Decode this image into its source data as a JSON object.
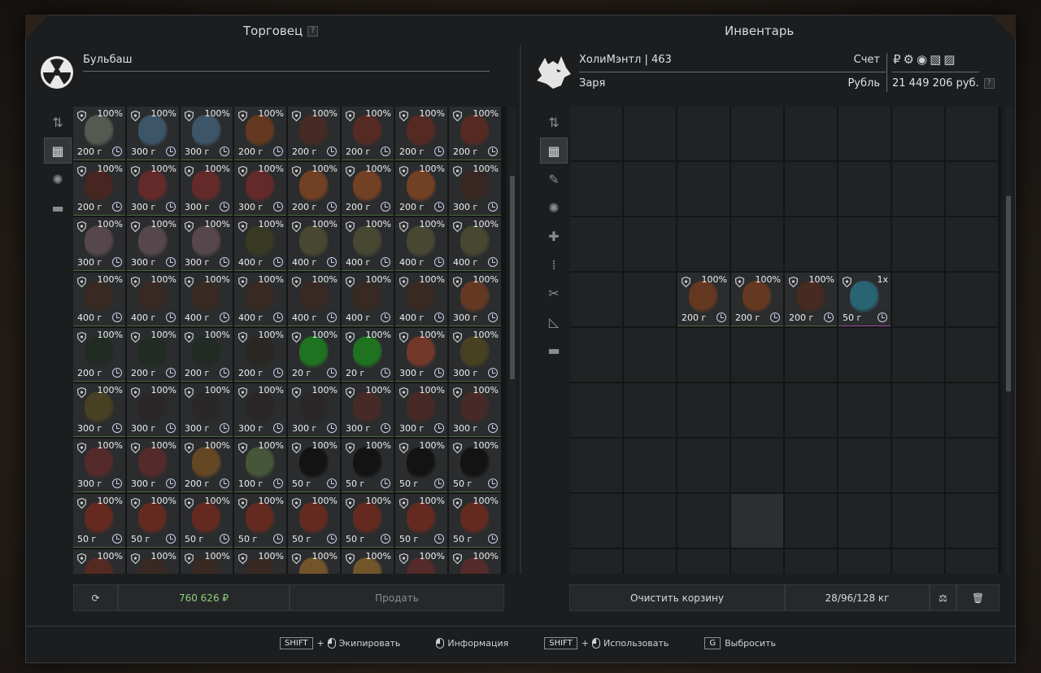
{
  "trader": {
    "title": "Торговец",
    "help": "?",
    "name": "Бульбаш",
    "total": "760 626 ₽",
    "sell_label": "Продать",
    "items": [
      {
        "pct": "100%",
        "price": "200 г",
        "color": "#5a5e54"
      },
      {
        "pct": "100%",
        "price": "300 г",
        "color": "#3e5a6e"
      },
      {
        "pct": "100%",
        "price": "300 г",
        "color": "#3e5a6e"
      },
      {
        "pct": "100%",
        "price": "200 г",
        "color": "#6a3a1e"
      },
      {
        "pct": "100%",
        "price": "200 г",
        "color": "#4a2a22"
      },
      {
        "pct": "100%",
        "price": "200 г",
        "color": "#5a2a22"
      },
      {
        "pct": "100%",
        "price": "200 г",
        "color": "#5a2a22"
      },
      {
        "pct": "100%",
        "price": "200 г",
        "color": "#5a2a22"
      },
      {
        "pct": "100%",
        "price": "200 г",
        "color": "#4a2420"
      },
      {
        "pct": "100%",
        "price": "300 г",
        "color": "#6a2a2a"
      },
      {
        "pct": "100%",
        "price": "300 г",
        "color": "#6a2a2a"
      },
      {
        "pct": "100%",
        "price": "300 г",
        "color": "#6a2a2a"
      },
      {
        "pct": "100%",
        "price": "200 г",
        "color": "#7a4222"
      },
      {
        "pct": "100%",
        "price": "200 г",
        "color": "#7a4222"
      },
      {
        "pct": "100%",
        "price": "200 г",
        "color": "#7a4222"
      },
      {
        "pct": "100%",
        "price": "300 г",
        "color": "#3a2620"
      },
      {
        "pct": "100%",
        "price": "300 г",
        "color": "#5a4a4e"
      },
      {
        "pct": "100%",
        "price": "300 г",
        "color": "#5a4a4e"
      },
      {
        "pct": "100%",
        "price": "300 г",
        "color": "#5a4a4e"
      },
      {
        "pct": "100%",
        "price": "400 г",
        "color": "#3a3a22"
      },
      {
        "pct": "100%",
        "price": "400 г",
        "color": "#4a4a32"
      },
      {
        "pct": "100%",
        "price": "400 г",
        "color": "#4a4a32"
      },
      {
        "pct": "100%",
        "price": "400 г",
        "color": "#4a4a32"
      },
      {
        "pct": "100%",
        "price": "400 г",
        "color": "#4a4a32"
      },
      {
        "pct": "100%",
        "price": "400 г",
        "color": "#3a2a22"
      },
      {
        "pct": "100%",
        "price": "400 г",
        "color": "#3a2a22"
      },
      {
        "pct": "100%",
        "price": "400 г",
        "color": "#3a2a22"
      },
      {
        "pct": "100%",
        "price": "400 г",
        "color": "#3a2a22"
      },
      {
        "pct": "100%",
        "price": "400 г",
        "color": "#3a2a22"
      },
      {
        "pct": "100%",
        "price": "400 г",
        "color": "#3a2a22"
      },
      {
        "pct": "100%",
        "price": "400 г",
        "color": "#3a2a22"
      },
      {
        "pct": "100%",
        "price": "300 г",
        "color": "#6a3a22"
      },
      {
        "pct": "100%",
        "price": "200 г",
        "color": "#202a22"
      },
      {
        "pct": "100%",
        "price": "200 г",
        "color": "#202a22"
      },
      {
        "pct": "100%",
        "price": "200 г",
        "color": "#202a22"
      },
      {
        "pct": "100%",
        "price": "200 г",
        "color": "#2a2622"
      },
      {
        "pct": "100%",
        "price": "20 г",
        "color": "#1e7a1e"
      },
      {
        "pct": "100%",
        "price": "20 г",
        "color": "#1e7a1e"
      },
      {
        "pct": "100%",
        "price": "300 г",
        "color": "#7a3a2a"
      },
      {
        "pct": "100%",
        "price": "300 г",
        "color": "#4a4220"
      },
      {
        "pct": "100%",
        "price": "300 г",
        "color": "#4a4220"
      },
      {
        "pct": "100%",
        "price": "300 г",
        "color": "#2a2626"
      },
      {
        "pct": "100%",
        "price": "300 г",
        "color": "#2a2626"
      },
      {
        "pct": "100%",
        "price": "300 г",
        "color": "#2a2626"
      },
      {
        "pct": "100%",
        "price": "300 г",
        "color": "#2a2626"
      },
      {
        "pct": "100%",
        "price": "300 г",
        "color": "#4a2a26"
      },
      {
        "pct": "100%",
        "price": "300 г",
        "color": "#4a2a26"
      },
      {
        "pct": "100%",
        "price": "300 г",
        "color": "#4a2a26"
      },
      {
        "pct": "100%",
        "price": "300 г",
        "color": "#5a2a2a"
      },
      {
        "pct": "100%",
        "price": "300 г",
        "color": "#5a2a2a"
      },
      {
        "pct": "100%",
        "price": "200 г",
        "color": "#6a4a22"
      },
      {
        "pct": "100%",
        "price": "100 г",
        "color": "#4a5a3a"
      },
      {
        "pct": "100%",
        "price": "50 г",
        "color": "#101010"
      },
      {
        "pct": "100%",
        "price": "50 г",
        "color": "#101010"
      },
      {
        "pct": "100%",
        "price": "50 г",
        "color": "#101010"
      },
      {
        "pct": "100%",
        "price": "50 г",
        "color": "#101010"
      },
      {
        "pct": "100%",
        "price": "50 г",
        "color": "#6a2a1e"
      },
      {
        "pct": "100%",
        "price": "50 г",
        "color": "#6a2a1e"
      },
      {
        "pct": "100%",
        "price": "50 г",
        "color": "#6a2a1e"
      },
      {
        "pct": "100%",
        "price": "50 г",
        "color": "#6a2a1e"
      },
      {
        "pct": "100%",
        "price": "50 г",
        "color": "#6a2a1e"
      },
      {
        "pct": "100%",
        "price": "50 г",
        "color": "#6a2a1e"
      },
      {
        "pct": "100%",
        "price": "50 г",
        "color": "#6a2a1e"
      },
      {
        "pct": "100%",
        "price": "50 г",
        "color": "#6a2a1e"
      },
      {
        "pct": "100%",
        "price": "",
        "color": "#5a2a22"
      },
      {
        "pct": "100%",
        "price": "",
        "color": "#3a2a22"
      },
      {
        "pct": "100%",
        "price": "",
        "color": "#3a2a22"
      },
      {
        "pct": "100%",
        "price": "",
        "color": "#3a2a22"
      },
      {
        "pct": "100%",
        "price": "",
        "color": "#7a5a2a"
      },
      {
        "pct": "100%",
        "price": "",
        "color": "#7a5a2a"
      },
      {
        "pct": "100%",
        "price": "",
        "color": "#5a2a2a"
      },
      {
        "pct": "100%",
        "price": "",
        "color": "#5a2a2a"
      }
    ]
  },
  "inventory": {
    "title": "Инвентарь",
    "player": "ХолиМэнтл | 463",
    "faction": "Заря",
    "account_label": "Счет",
    "currency_label": "Рубль",
    "currency_icons": "₽⚙◉▧▨",
    "balance": "21 449 206 руб.",
    "help": "?",
    "clear_label": "Очистить корзину",
    "weight": "28/96/128 кг",
    "items": [
      {
        "pct": "100%",
        "price": "200 г",
        "color": "#6a3a1e"
      },
      {
        "pct": "100%",
        "price": "200 г",
        "color": "#6a3a1e"
      },
      {
        "pct": "100%",
        "price": "200 г",
        "color": "#4a2a1e"
      },
      {
        "pct": "1x",
        "price": "50 г",
        "color": "#2a6a7a"
      }
    ]
  },
  "footer": {
    "shift_key": "SHIFT",
    "plus": "+",
    "equip": "Экипировать",
    "info": "Информация",
    "use": "Использовать",
    "g_key": "G",
    "drop": "Выбросить"
  }
}
